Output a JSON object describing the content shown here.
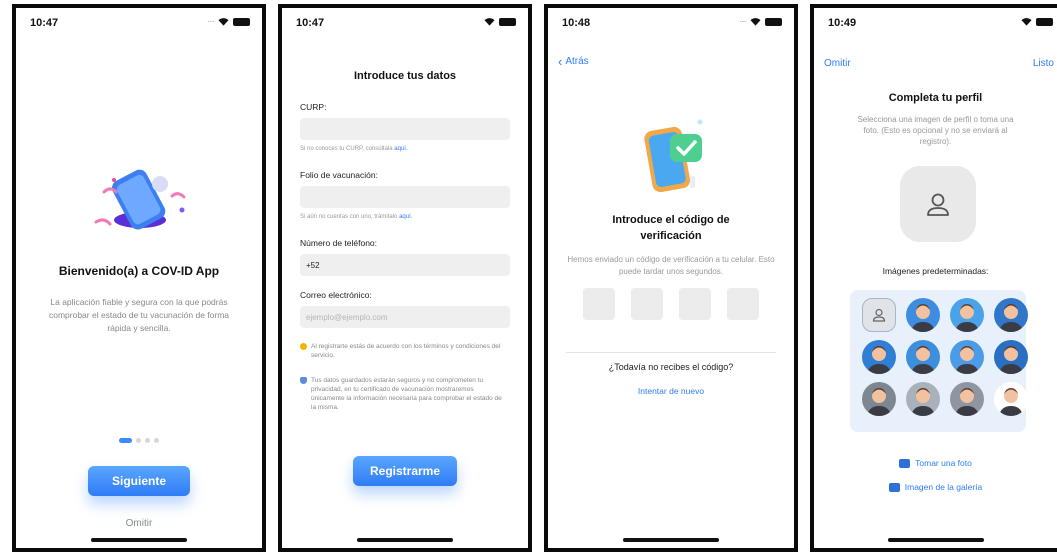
{
  "screen1": {
    "time": "10:47",
    "title": "Bienvenido(a) a COV-ID App",
    "description": "La aplicación fiable y segura con la que podrás comprobar el estado de tu vacunación de forma rápida y sencilla.",
    "primary_button": "Siguiente",
    "skip": "Omitir",
    "pager": {
      "total": 4,
      "active": 1
    }
  },
  "screen2": {
    "time": "10:47",
    "title": "Introduce tus datos",
    "fields": {
      "curp": {
        "label": "CURP:",
        "value": "",
        "placeholder": "",
        "hint": "Si no conoces tu CURP, consúltala",
        "hint_link": "aquí."
      },
      "folio": {
        "label": "Folio de vacunación:",
        "value": "",
        "placeholder": "",
        "hint": "Si aún no cuentas con uno, trámitalo",
        "hint_link": "aquí."
      },
      "phone": {
        "label": "Número de teléfono:",
        "value": "+52",
        "placeholder": ""
      },
      "email": {
        "label": "Correo electrónico:",
        "value": "",
        "placeholder": "ejemplo@ejemplo.com"
      }
    },
    "notices": [
      "Al registrarte estás de acuerdo con los términos y condiciones del servicio.",
      "Tus datos guardados estarán seguros y no comprometen tu privacidad, en tu certificado de vacunación mostraremos únicamente la información necesaria para comprobar el estado de la misma."
    ],
    "primary_button": "Registrarme"
  },
  "screen3": {
    "time": "10:48",
    "back": "Atrás",
    "title": "Introduce el código de verificación",
    "description": "Hemos enviado un código de verificación a tu celular. Esto puede tardar unos segundos.",
    "code_boxes": [
      "",
      "",
      "",
      ""
    ],
    "resend_question": "¿Todavía no recibes el código?",
    "retry": "Intentar de nuevo"
  },
  "screen4": {
    "time": "10:49",
    "skip": "Omitir",
    "done": "Listo",
    "title": "Completa tu perfil",
    "description": "Selecciona una imagen de perfil o toma una foto. (Esto es opcional y no se enviará al registro).",
    "default_images_title": "Imágenes predeterminadas:",
    "avatars": [
      {
        "kind": "placeholder",
        "selected": true,
        "color": "#e0e3e8"
      },
      {
        "kind": "face",
        "color": "#3e8de0"
      },
      {
        "kind": "face",
        "color": "#4aa3e8"
      },
      {
        "kind": "face",
        "color": "#3076c9"
      },
      {
        "kind": "face",
        "color": "#2f7fd6"
      },
      {
        "kind": "face",
        "color": "#3c8fde"
      },
      {
        "kind": "face",
        "color": "#4b9be6"
      },
      {
        "kind": "face",
        "color": "#2a6fc2"
      },
      {
        "kind": "face",
        "color": "#7d8792"
      },
      {
        "kind": "face",
        "color": "#a9b1bb"
      },
      {
        "kind": "face",
        "color": "#8e96a1"
      },
      {
        "kind": "face",
        "color": "#ffffff"
      }
    ],
    "take_photo": "Tomar una foto",
    "gallery": "Imagen de la galería"
  },
  "colors": {
    "accent": "#2f7cf6",
    "input_bg": "#efefef",
    "muted_text": "#888888"
  }
}
